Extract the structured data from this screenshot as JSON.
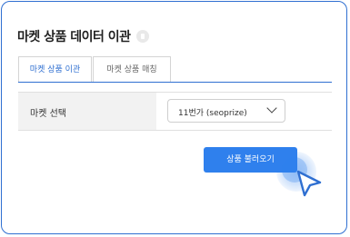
{
  "page": {
    "title": "마켓 상품 데이터 이관",
    "help_icon": "help-icon"
  },
  "tabs": [
    {
      "label": "마켓 상품 이관",
      "active": true
    },
    {
      "label": "마켓 상품 매칭",
      "active": false
    }
  ],
  "form": {
    "market_label": "마켓 선택",
    "market_select_value": "11번가 (seoprize)",
    "dropdown_icon": "chevron-down-icon"
  },
  "actions": {
    "load_button_label": "상품 불러오기"
  },
  "pointer": {
    "icon": "cursor-arrow-icon"
  },
  "colors": {
    "accent": "#2f80ed",
    "border": "#2f6fd1",
    "label_background": "#f2f2f2"
  }
}
